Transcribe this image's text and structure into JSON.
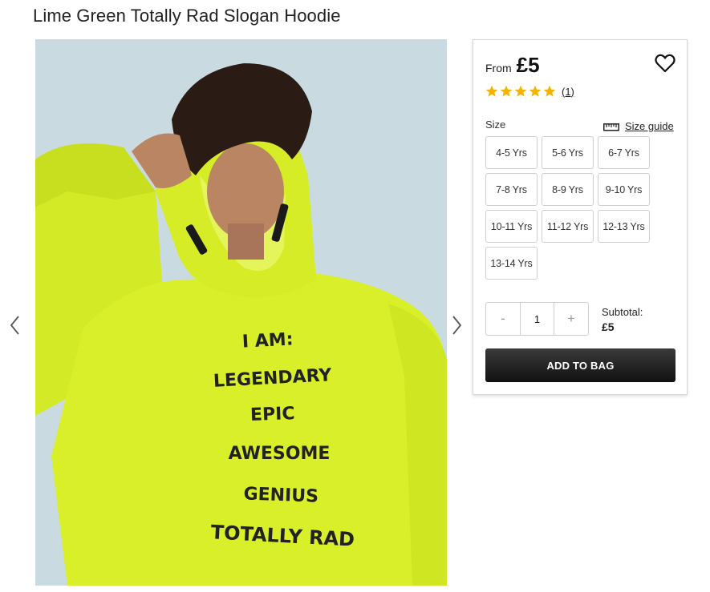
{
  "product": {
    "title": "Lime Green Totally Rad Slogan Hoodie",
    "image_alt": "Boy wearing lime green hoodie with slogan print",
    "print_text": [
      "I AM:",
      "LEGENDARY",
      "EPIC",
      "AWESOME",
      "GENIUS",
      "TOTALLY RAD"
    ]
  },
  "gallery": {
    "prev_icon": "chevron-left-icon",
    "next_icon": "chevron-right-icon"
  },
  "pricing": {
    "from_label": "From",
    "price": "£5"
  },
  "rating": {
    "stars": 5,
    "max": 5,
    "count_label": "(1)",
    "star_color": "#f5b301"
  },
  "size": {
    "label": "Size",
    "guide_label": "Size guide",
    "options": [
      "4-5 Yrs",
      "5-6 Yrs",
      "6-7 Yrs",
      "7-8 Yrs",
      "8-9 Yrs",
      "9-10 Yrs",
      "10-11 Yrs",
      "11-12 Yrs",
      "12-13 Yrs",
      "13-14 Yrs"
    ]
  },
  "quantity": {
    "minus": "-",
    "value": "1",
    "plus": "+"
  },
  "subtotal": {
    "label": "Subtotal:",
    "value": "£5"
  },
  "cta": {
    "label": "ADD TO BAG"
  },
  "colors": {
    "hoodie": "#d9ef2a",
    "background": "#c9dbe0",
    "button_dark": "#1a1a1a"
  }
}
